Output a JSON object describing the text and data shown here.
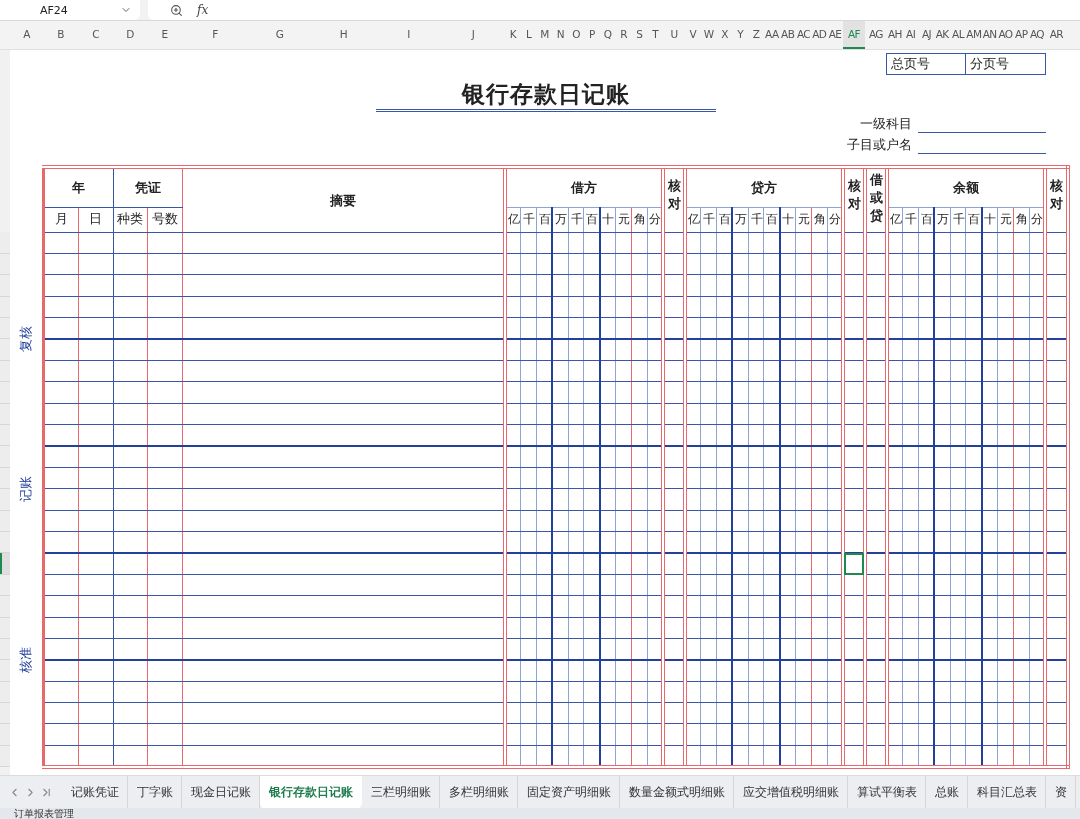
{
  "formula_bar": {
    "name_box": "AF24",
    "function_label": "fx"
  },
  "column_headers": [
    {
      "label": "A",
      "selected": false
    },
    {
      "label": "B",
      "selected": false
    },
    {
      "label": "C",
      "selected": false
    },
    {
      "label": "D",
      "selected": false
    },
    {
      "label": "E",
      "selected": false
    },
    {
      "label": "F",
      "selected": false
    },
    {
      "label": "G",
      "selected": false
    },
    {
      "label": "H",
      "selected": false
    },
    {
      "label": "I",
      "selected": false
    },
    {
      "label": "J",
      "selected": false
    },
    {
      "label": "K",
      "selected": false
    },
    {
      "label": "L",
      "selected": false
    },
    {
      "label": "M",
      "selected": false
    },
    {
      "label": "N",
      "selected": false
    },
    {
      "label": "O",
      "selected": false
    },
    {
      "label": "P",
      "selected": false
    },
    {
      "label": "Q",
      "selected": false
    },
    {
      "label": "R",
      "selected": false
    },
    {
      "label": "S",
      "selected": false
    },
    {
      "label": "T",
      "selected": false
    },
    {
      "label": "U",
      "selected": false
    },
    {
      "label": "V",
      "selected": false
    },
    {
      "label": "W",
      "selected": false
    },
    {
      "label": "X",
      "selected": false
    },
    {
      "label": "Y",
      "selected": false
    },
    {
      "label": "Z",
      "selected": false
    },
    {
      "label": "AA",
      "selected": false
    },
    {
      "label": "AB",
      "selected": false
    },
    {
      "label": "AC",
      "selected": false
    },
    {
      "label": "AD",
      "selected": false
    },
    {
      "label": "AE",
      "selected": false
    },
    {
      "label": "AF",
      "selected": true
    },
    {
      "label": "AG",
      "selected": false
    },
    {
      "label": "AH",
      "selected": false
    },
    {
      "label": "AI",
      "selected": false
    },
    {
      "label": "AJ",
      "selected": false
    },
    {
      "label": "AK",
      "selected": false
    },
    {
      "label": "AL",
      "selected": false
    },
    {
      "label": "AM",
      "selected": false
    },
    {
      "label": "AN",
      "selected": false
    },
    {
      "label": "AO",
      "selected": false
    },
    {
      "label": "AP",
      "selected": false
    },
    {
      "label": "AQ",
      "selected": false
    },
    {
      "label": "AR",
      "selected": false
    }
  ],
  "report": {
    "page_fields": [
      "总页号",
      "分页号"
    ],
    "title": "银行存款日记账",
    "subject_fields": [
      "一级科目",
      "子目或户名"
    ]
  },
  "ledger": {
    "date": "年",
    "date_parts": [
      "月",
      "日"
    ],
    "voucher": "凭证",
    "voucher_parts": [
      "种类",
      "号数"
    ],
    "summary": "摘要",
    "columns": [
      {
        "kind": "amount",
        "label": "借方",
        "digits": [
          "亿",
          "千",
          "百",
          "万",
          "千",
          "百",
          "十",
          "元",
          "角",
          "分"
        ]
      },
      {
        "kind": "check",
        "label": "核对"
      },
      {
        "kind": "amount",
        "label": "贷方",
        "digits": [
          "亿",
          "千",
          "百",
          "万",
          "千",
          "百",
          "十",
          "元",
          "角",
          "分"
        ]
      },
      {
        "kind": "check",
        "label": "核对"
      },
      {
        "kind": "mark",
        "label": "借或贷"
      },
      {
        "kind": "amount",
        "label": "余额",
        "digits": [
          "亿",
          "千",
          "百",
          "万",
          "千",
          "百",
          "十",
          "元",
          "角",
          "分"
        ]
      },
      {
        "kind": "check",
        "label": "核对"
      }
    ],
    "side_labels": [
      "复核",
      "记账",
      "核准"
    ],
    "rows": [
      {
        "selected": false
      },
      {
        "selected": false
      },
      {
        "selected": false
      },
      {
        "selected": false
      },
      {
        "selected": false
      },
      {
        "selected": false
      },
      {
        "selected": false
      },
      {
        "selected": false
      },
      {
        "selected": false
      },
      {
        "selected": false
      },
      {
        "selected": false
      },
      {
        "selected": false
      },
      {
        "selected": false
      },
      {
        "selected": false
      },
      {
        "selected": false
      },
      {
        "selected": true
      },
      {
        "selected": false
      },
      {
        "selected": false
      },
      {
        "selected": false
      },
      {
        "selected": false
      },
      {
        "selected": false
      },
      {
        "selected": false
      },
      {
        "selected": false
      },
      {
        "selected": false
      },
      {
        "selected": false
      }
    ]
  },
  "sheet_tabs": [
    {
      "label": "记账凭证",
      "selected": false
    },
    {
      "label": "丁字账",
      "selected": false
    },
    {
      "label": "现金日记账",
      "selected": false
    },
    {
      "label": "银行存款日记账",
      "selected": true
    },
    {
      "label": "三栏明细账",
      "selected": false
    },
    {
      "label": "多栏明细账",
      "selected": false
    },
    {
      "label": "固定资产明细账",
      "selected": false
    },
    {
      "label": "数量金额式明细账",
      "selected": false
    },
    {
      "label": "应交增值税明细账",
      "selected": false
    },
    {
      "label": "算试平衡表",
      "selected": false
    },
    {
      "label": "总账",
      "selected": false
    },
    {
      "label": "科目汇总表",
      "selected": false
    },
    {
      "label": "资",
      "selected": false
    }
  ],
  "status_bar": {
    "text": "订单报表管理"
  }
}
